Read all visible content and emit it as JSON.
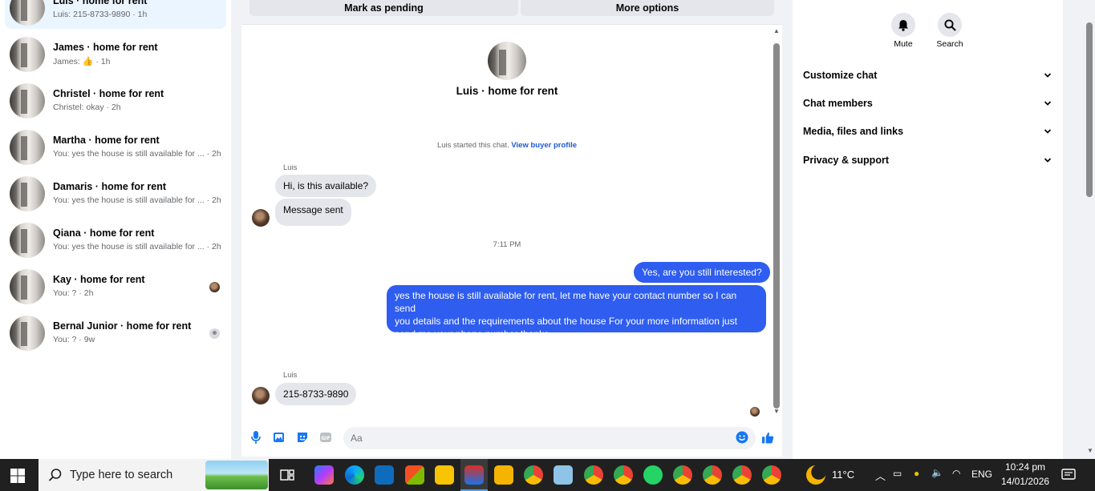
{
  "conversations": [
    {
      "name": "Luis · home for rent",
      "snippet": "Luis: 215-8733-9890 · 1h",
      "active": true
    },
    {
      "name": "James · home for rent",
      "snippet_prefix": "James: ",
      "snippet_suffix": " · 1h",
      "icon": "thumbs-up-icon"
    },
    {
      "name": "Christel · home for rent",
      "snippet": "Christel: okay · 2h"
    },
    {
      "name": "Martha · home for rent",
      "snippet": "You: yes the house is still available for ... · 2h"
    },
    {
      "name": "Damaris · home for rent",
      "snippet": "You: yes the house is still available for ... · 2h"
    },
    {
      "name": "Qiana · home for rent",
      "snippet": "You: yes the house is still available for ... · 2h"
    },
    {
      "name": "Kay · home for rent",
      "snippet": "You: ? · 2h"
    },
    {
      "name": "Bernal Junior · home for rent",
      "snippet": "You: ? · 9w"
    }
  ],
  "chat": {
    "top_actions": {
      "pending": "Mark as pending",
      "more": "More options"
    },
    "title": "Luis · home for rent",
    "started_text": "Luis started this chat.",
    "started_link": "View buyer profile",
    "sender": "Luis",
    "incoming_1": "Hi, is this available?",
    "incoming_2": "Message sent",
    "time_divider": "7:11 PM",
    "outgoing_1": "Yes, are you still interested?",
    "outgoing_2_lines": [
      "yes the house is still available for rent, let me have your contact number so I can send",
      "you details and the requirements about the house For  your  more  information  just",
      "send  me   your  phone  number thanks."
    ],
    "sender_2": "Luis",
    "incoming_3": "215-8733-9890",
    "composer_placeholder": "Aa"
  },
  "details": {
    "mute_label": "Mute",
    "search_label": "Search",
    "rows": [
      "Customize chat",
      "Chat members",
      "Media, files and links",
      "Privacy & support"
    ]
  },
  "taskbar": {
    "search_placeholder": "Type here to search",
    "weather": "11°C",
    "language": "ENG",
    "time": "10:24 pm",
    "date": "14/01/2026"
  },
  "colors": {
    "accent": "#2e5df0",
    "link": "#1c5ad6",
    "like": "#1877f2"
  }
}
